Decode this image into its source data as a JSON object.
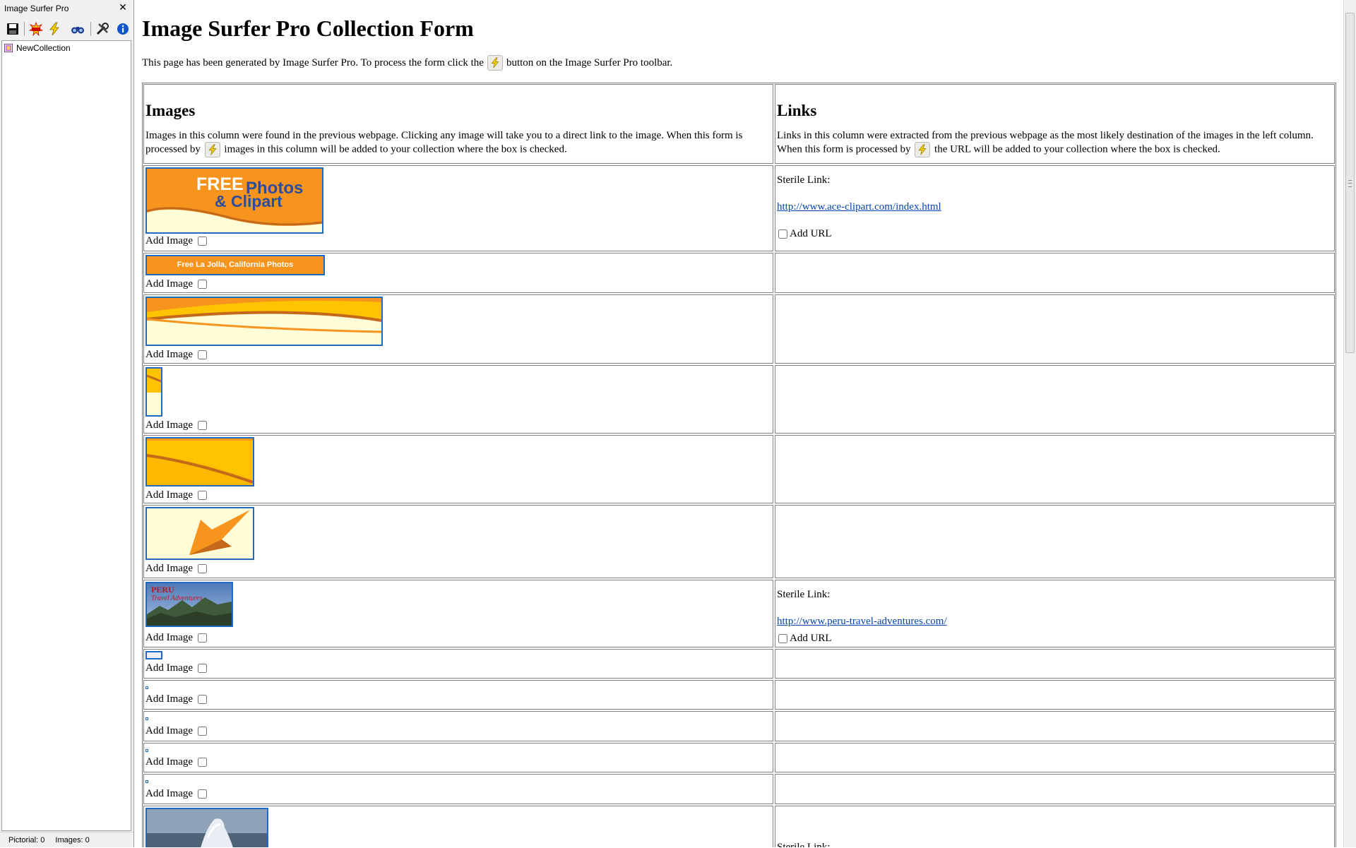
{
  "panel": {
    "title": "Image Surfer Pro",
    "close_glyph": "✕",
    "toolbar": [
      {
        "icon": "save-icon"
      },
      {
        "icon": "bam-icon"
      },
      {
        "icon": "lightning-icon"
      },
      {
        "icon": "binoculars-icon"
      },
      {
        "icon": "tools-icon"
      },
      {
        "icon": "info-icon"
      }
    ],
    "tree": {
      "items": [
        {
          "label": "NewCollection",
          "icon": "collection-icon"
        }
      ]
    },
    "status": {
      "pictorial": "Pictorial: 0",
      "images": "Images: 0"
    }
  },
  "page": {
    "title": "Image Surfer Pro Collection Form",
    "intro_before": "This page has been generated by Image Surfer Pro. To process the form click the",
    "intro_after": "button on the Image Surfer Pro toolbar.",
    "images_col": {
      "heading": "Images",
      "desc_before": "Images in this column were found in the previous webpage. Clicking any image will take you to a direct link to the image. When this form is processed by",
      "desc_after": "images in this column will be added to your collection where the box is checked."
    },
    "links_col": {
      "heading": "Links",
      "desc_before": "Links in this column were extracted from the previous webpage as the most likely destination of the images in the left column. When this form is processed by",
      "desc_after": "the URL will be added to your collection where the box is checked."
    },
    "add_image_label": "Add Image",
    "add_url_label": "Add URL",
    "sterile_label": "Sterile Link:",
    "banner_free": "FREE",
    "banner_photos": "Photos",
    "banner_clipart": "& Clipart",
    "banner_lajolla": "Free La Jolla, California Photos",
    "peru_title": "PERU",
    "peru_subtitle": "Travel Adventures",
    "links": {
      "row1": "http://www.ace-clipart.com/index.html",
      "row7": "http://www.peru-travel-adventures.com/"
    }
  },
  "colors": {
    "accent_orange": "#f7941d",
    "cream": "#fffcd8",
    "link_blue": "#0645ad",
    "thumb_border": "#1f6bc1"
  }
}
